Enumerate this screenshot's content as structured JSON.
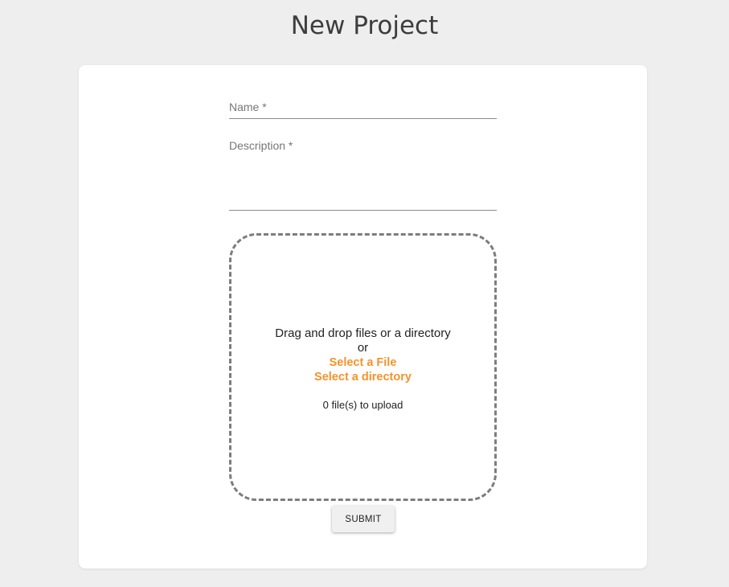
{
  "page": {
    "title": "New Project"
  },
  "form": {
    "name_label": "Name *",
    "description_label": "Description *",
    "dropzone": {
      "drag_text": "Drag and drop files or a directory",
      "or_text": "or",
      "select_file_label": "Select a File",
      "select_directory_label": "Select a directory",
      "file_count_text": "0 file(s) to upload"
    },
    "submit_label": "SUBMIT"
  },
  "colors": {
    "background": "#eeeeee",
    "card": "#ffffff",
    "accent_link": "#f7922a",
    "dropzone_border": "#7d7d7d"
  }
}
